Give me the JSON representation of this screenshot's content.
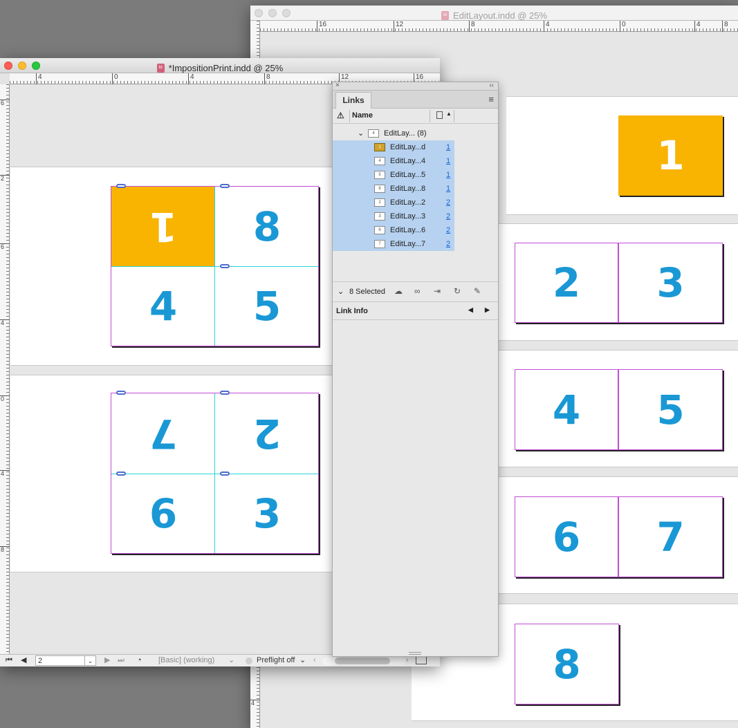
{
  "back_window": {
    "title": "EditLayout.indd @ 25%",
    "ruler_labels": [
      "16",
      "12",
      "8",
      "4",
      "0",
      "4",
      "8"
    ],
    "vruler_labels": [
      "4"
    ],
    "pages": [
      {
        "number": "1",
        "highlight": true
      },
      {
        "number": "2"
      },
      {
        "number": "3"
      },
      {
        "number": "4"
      },
      {
        "number": "5"
      },
      {
        "number": "6"
      },
      {
        "number": "7"
      },
      {
        "number": "8"
      }
    ]
  },
  "front_window": {
    "title": "*ImpositionPrint.indd @ 25%",
    "ruler_labels": [
      "4",
      "0",
      "4",
      "8",
      "12",
      "16"
    ],
    "vruler_labels": [
      "6",
      "2",
      "6",
      "4",
      "0",
      "4",
      "8"
    ],
    "spread1": [
      {
        "number": "1",
        "flipped": true,
        "highlight": true
      },
      {
        "number": "8"
      },
      {
        "number": "4"
      },
      {
        "number": "5"
      }
    ],
    "spread2": [
      {
        "number": "7",
        "flipped": true
      },
      {
        "number": "2",
        "flipped": true
      },
      {
        "number": "6"
      },
      {
        "number": "3"
      }
    ],
    "status": {
      "page_value": "2",
      "style": "[Basic] (working)",
      "preflight": "Preflight off"
    }
  },
  "links_panel": {
    "tab": "Links",
    "column_name": "Name",
    "group": {
      "label": "EditLay... (8)",
      "thumb": "4"
    },
    "rows": [
      {
        "name": "EditLay...d",
        "page": "1",
        "thumb": "1"
      },
      {
        "name": "EditLay...4",
        "page": "1",
        "thumb": "4"
      },
      {
        "name": "EditLay...5",
        "page": "1",
        "thumb": "5"
      },
      {
        "name": "EditLay...8",
        "page": "1",
        "thumb": "8"
      },
      {
        "name": "EditLay...2",
        "page": "2",
        "thumb": "2"
      },
      {
        "name": "EditLay...3",
        "page": "2",
        "thumb": "3"
      },
      {
        "name": "EditLay...6",
        "page": "2",
        "thumb": "6"
      },
      {
        "name": "EditLay...7",
        "page": "2",
        "thumb": "7"
      }
    ],
    "selected_count": "8 Selected",
    "link_info": "Link Info"
  },
  "colors": {
    "highlight": "#f8b400",
    "number": "#1a98d5",
    "page_border": "#c24bd6",
    "guide": "#27d3d9",
    "selection": "#b7d2f0"
  },
  "icons": [
    "warning-icon",
    "page-icon",
    "panel-menu-icon",
    "relink-cc-icon",
    "relink-icon",
    "go-to-link-icon",
    "update-link-icon",
    "edit-original-icon"
  ]
}
